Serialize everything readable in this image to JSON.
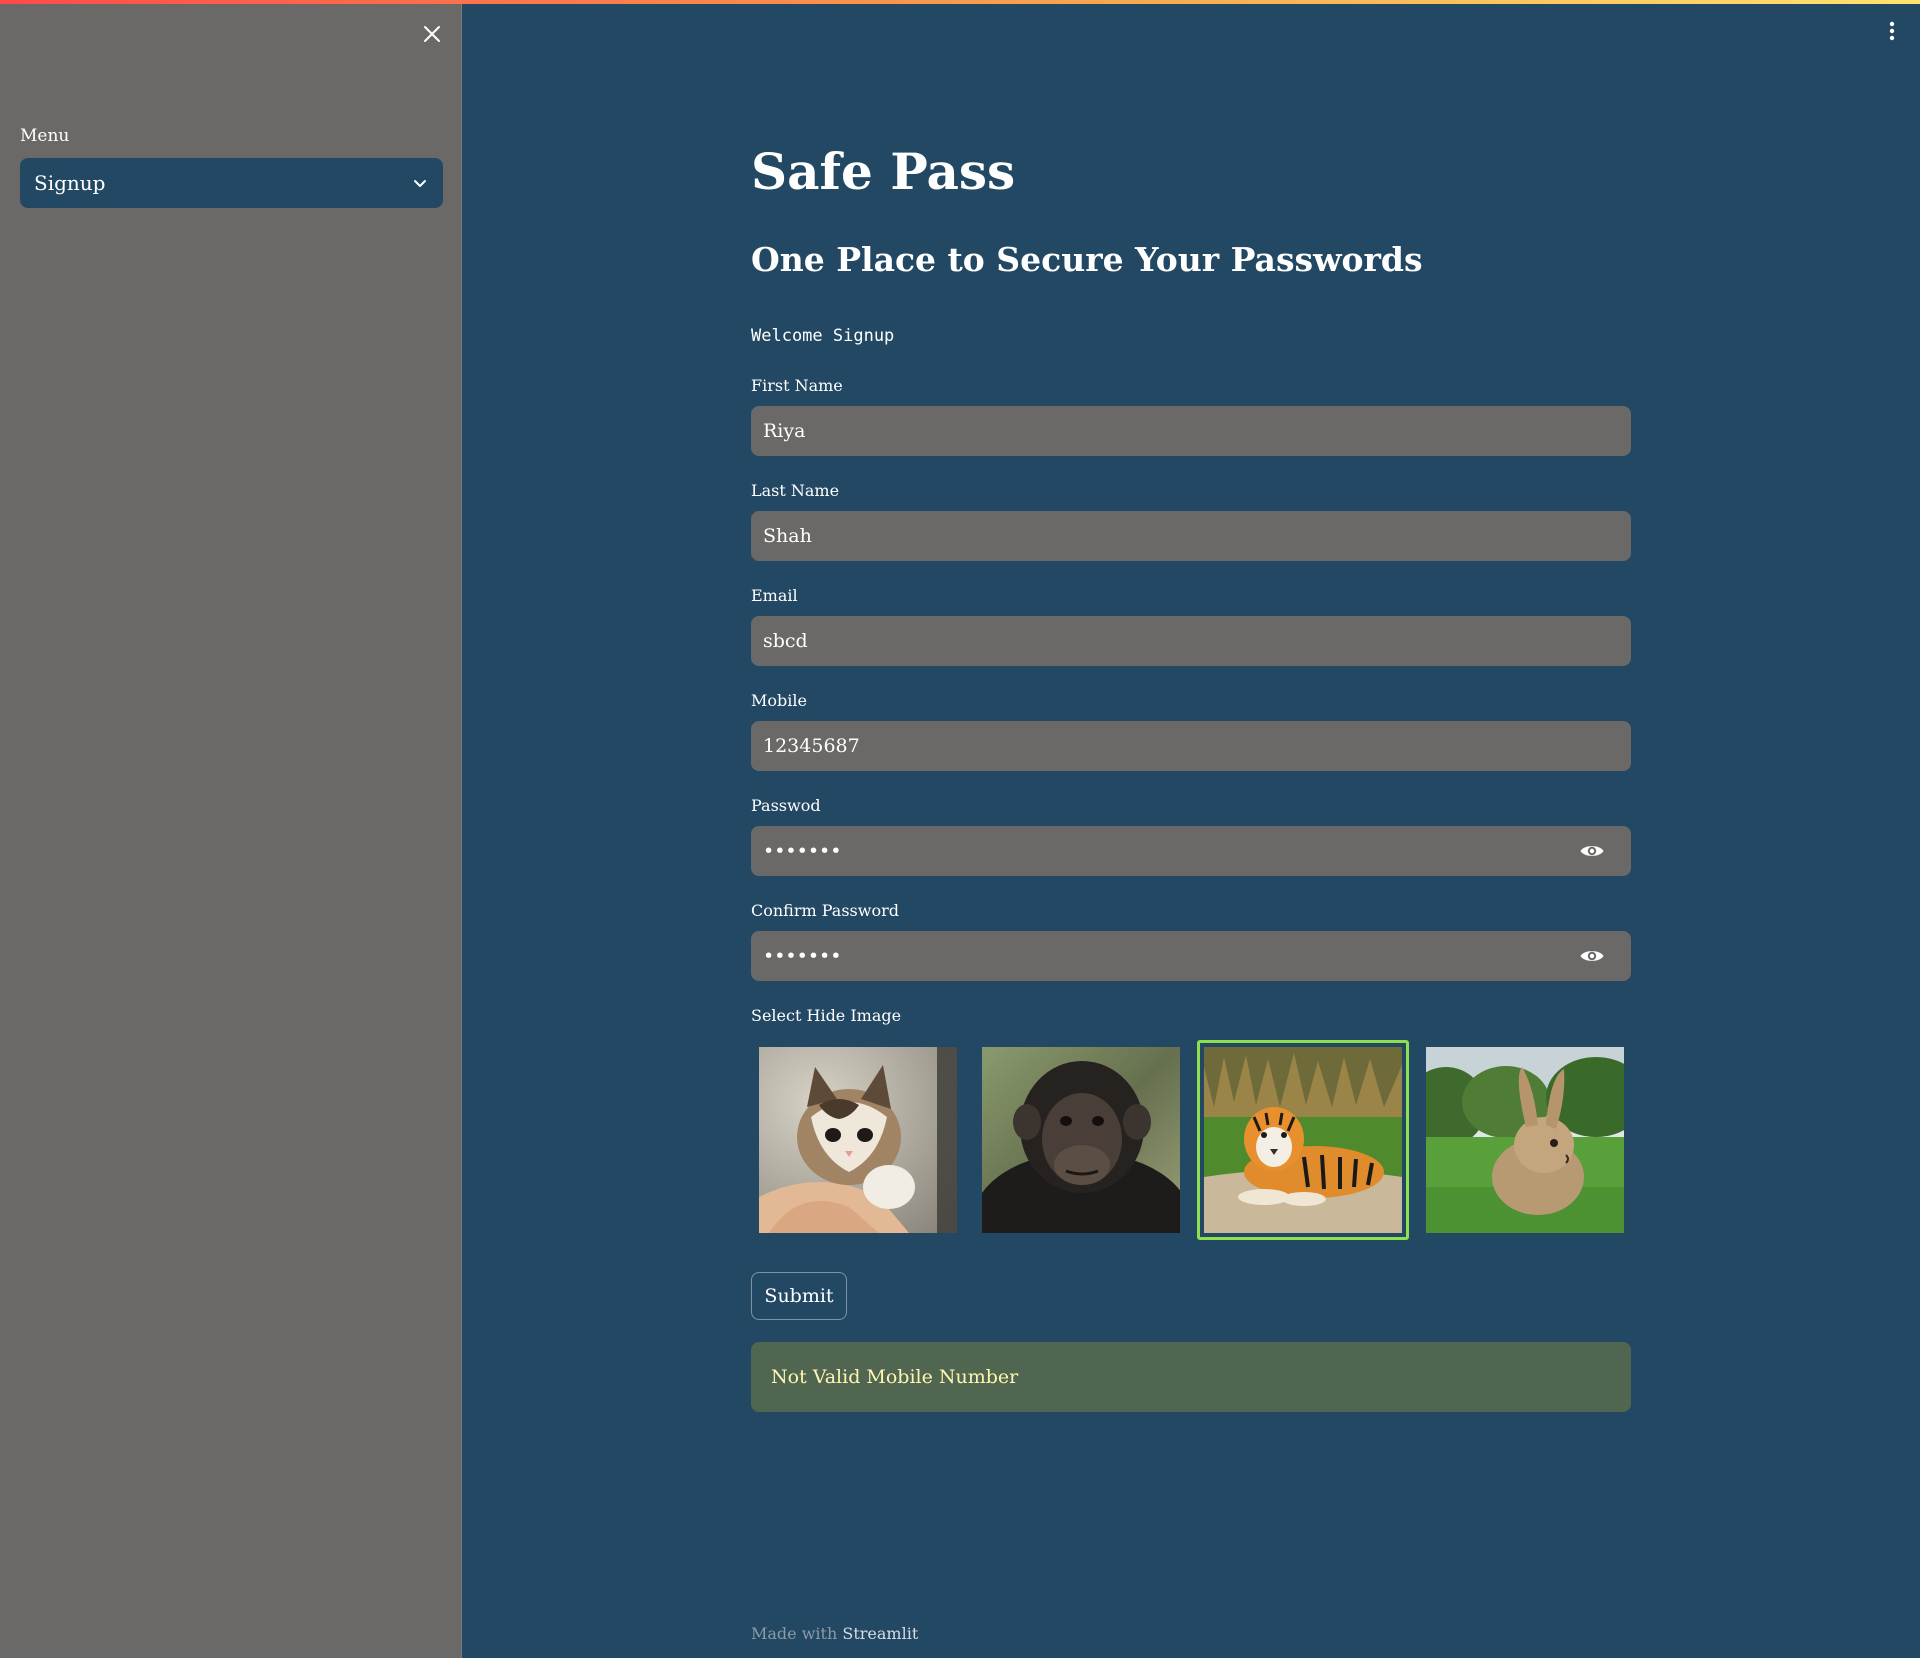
{
  "sidebar": {
    "close_icon": "close-icon",
    "menu_label": "Menu",
    "menu_value": "Signup"
  },
  "main": {
    "title": "Safe Pass",
    "subtitle": "One Place to Secure Your Passwords",
    "welcome": "Welcome Signup",
    "fields": {
      "first_name": {
        "label": "First Name",
        "value": "Riya"
      },
      "last_name": {
        "label": "Last Name",
        "value": "Shah"
      },
      "email": {
        "label": "Email",
        "value": "sbcd"
      },
      "mobile": {
        "label": "Mobile",
        "value": "12345687"
      },
      "password": {
        "label": "Passwod",
        "value": "•••••••"
      },
      "confirm_password": {
        "label": "Confirm Password",
        "value": "•••••••"
      }
    },
    "image_picker": {
      "label": "Select Hide Image",
      "options": [
        "kitten",
        "chimpanzee",
        "tiger",
        "rabbit"
      ],
      "selected": "tiger",
      "selected_color": "#8fe04c"
    },
    "submit_label": "Submit",
    "alert": "Not Valid Mobile Number",
    "footer": {
      "prefix": "Made with",
      "brand": "Streamlit"
    }
  },
  "colors": {
    "background": "#234863",
    "sidebar": "#6b6968",
    "input": "#6b6968",
    "alert_bg": "#506650",
    "alert_text": "#fff6b0"
  }
}
